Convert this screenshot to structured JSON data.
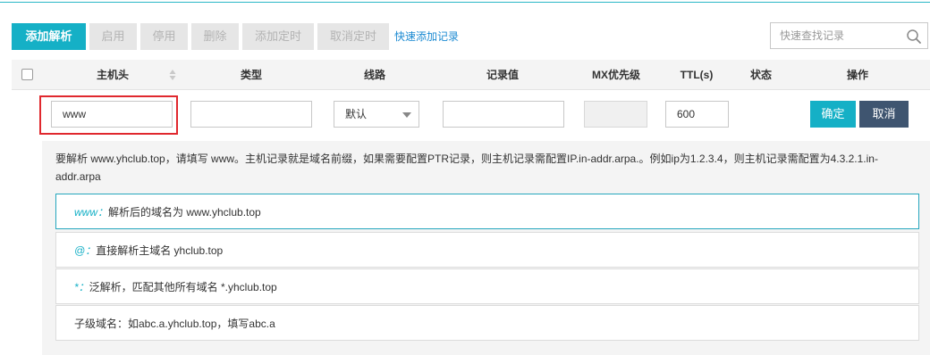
{
  "toolbar": {
    "add_label": "添加解析",
    "enable_label": "启用",
    "disable_label": "停用",
    "delete_label": "删除",
    "add_timer_label": "添加定时",
    "cancel_timer_label": "取消定时",
    "quick_add_label": "快速添加记录"
  },
  "search": {
    "placeholder": "快速查找记录",
    "icon": "search-icon"
  },
  "table": {
    "headers": {
      "host": "主机头",
      "type": "类型",
      "line": "线路",
      "value": "记录值",
      "mx": "MX优先级",
      "ttl": "TTL(s)",
      "status": "状态",
      "action": "操作"
    }
  },
  "edit_row": {
    "host_value": "www",
    "type_value": "",
    "line_value": "默认",
    "record_value": "",
    "mx_value": "",
    "ttl_value": "600",
    "ok_label": "确定",
    "cancel_label": "取消",
    "highlight_color": "#e0282e"
  },
  "help": {
    "description": "要解析 www.yhclub.top，请填写 www。主机记录就是域名前缀，如果需要配置PTR记录，则主机记录需配置IP.in-addr.arpa.。例如ip为1.2.3.4，则主机记录需配置为4.3.2.1.in-addr.arpa",
    "hints": [
      {
        "key": "www：",
        "text": "解析后的域名为 www.yhclub.top"
      },
      {
        "key": "@：",
        "text": "直接解析主域名 yhclub.top"
      },
      {
        "key": "*：",
        "text": "泛解析，匹配其他所有域名 *.yhclub.top"
      },
      {
        "key": "",
        "text": "子级域名：如abc.a.yhclub.top，填写abc.a"
      }
    ]
  },
  "colors": {
    "primary": "#15b0c6",
    "dark_button": "#3f5570",
    "link": "#1b8ad2"
  }
}
